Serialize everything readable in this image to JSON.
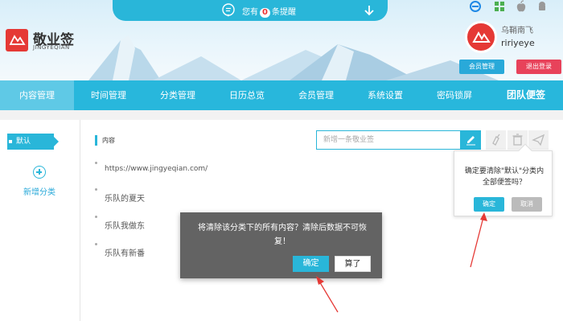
{
  "header": {
    "notice_prefix": "您有",
    "notice_count": "0",
    "notice_suffix": "条提醒",
    "logo_title": "敬业签",
    "logo_sub": "JINGYEQIAN",
    "user_name": "乌鞘南飞",
    "user_id": "ririyeye",
    "member_button": "会员管理",
    "logout_button": "退出登录"
  },
  "nav": {
    "items": [
      {
        "label": "内容管理"
      },
      {
        "label": "时间管理"
      },
      {
        "label": "分类管理"
      },
      {
        "label": "日历总览"
      },
      {
        "label": "会员管理"
      },
      {
        "label": "系统设置"
      },
      {
        "label": "密码锁屏"
      },
      {
        "label": "团队便签"
      }
    ]
  },
  "sidebar": {
    "default_label": "默认",
    "add_label": "新增分类"
  },
  "main": {
    "tab_label": "内容",
    "search_placeholder": "新增一条敬业签",
    "notes": [
      {
        "text": "https://www.jingyeqian.com/"
      },
      {
        "text": "乐队的夏天"
      },
      {
        "text": "乐队我做东"
      },
      {
        "text": "乐队有新番"
      }
    ]
  },
  "popover": {
    "message": "确定要清除\"默认\"分类内全部便签吗？",
    "ok": "确定",
    "cancel": "取消"
  },
  "modal": {
    "message": "将清除该分类下的所有内容？清除后数据不可恢复！",
    "ok": "确定",
    "cancel": "算了"
  },
  "colors": {
    "accent": "#29b6d9",
    "danger": "#e53935",
    "logout": "#e8425a"
  }
}
